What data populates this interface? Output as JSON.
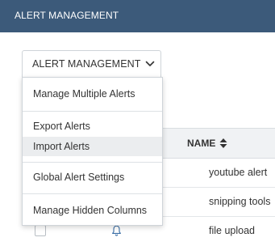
{
  "header": {
    "title": "ALERT MANAGEMENT"
  },
  "dropdown": {
    "label": "ALERT MANAGEMENT",
    "items": [
      {
        "label": "Manage Multiple Alerts"
      },
      {
        "label": "Export Alerts"
      },
      {
        "label": "Import Alerts"
      },
      {
        "label": "Global Alert Settings"
      },
      {
        "label": "Manage Hidden Columns"
      }
    ]
  },
  "table": {
    "columns": [
      "NAME"
    ],
    "rows": [
      {
        "name": "youtube alert"
      },
      {
        "name": "snipping tools"
      },
      {
        "name": "file upload"
      }
    ]
  },
  "colors": {
    "header_bg": "#3c5a7a",
    "hover_bg": "#ebedef"
  }
}
